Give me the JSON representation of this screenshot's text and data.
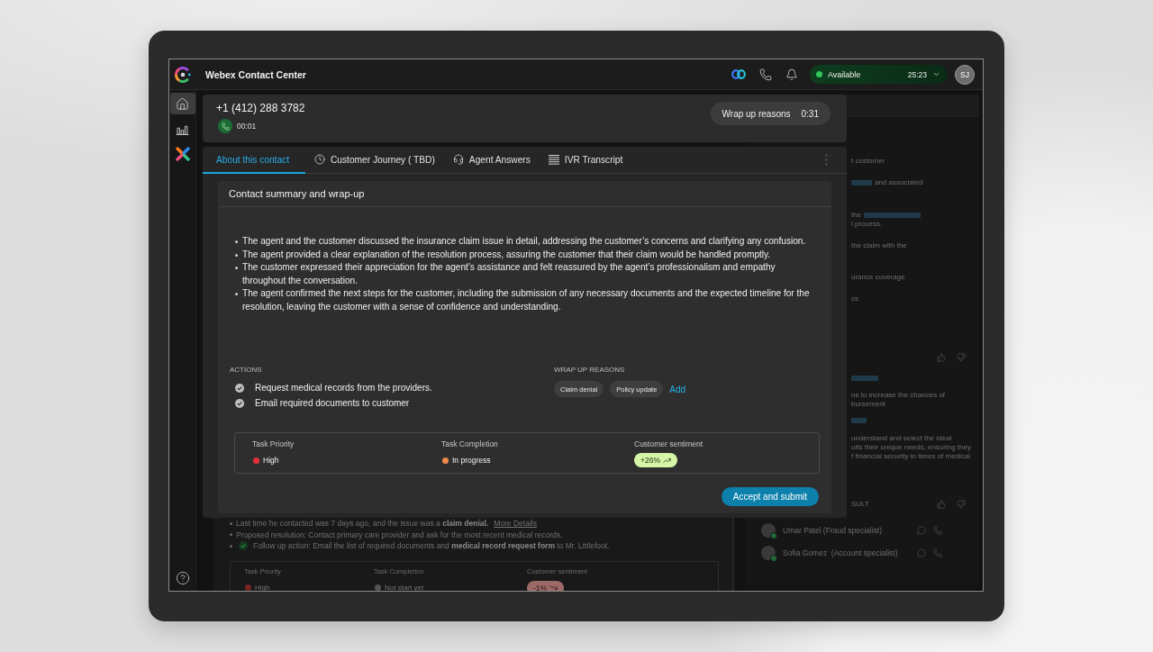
{
  "app_bar": {
    "title": "Webex Contact Center",
    "status": {
      "label": "Available",
      "timer": "25:23"
    },
    "avatar_initials": "SJ"
  },
  "nav_rail": {
    "items": [
      {
        "selected": true
      },
      {
        "selected": false
      },
      {
        "selected": false
      }
    ]
  },
  "call_header": {
    "phone_number": "+1 (412) 288 3782",
    "call_timer": "00:01",
    "wrap_up": {
      "label": "Wrap up reasons",
      "timer": "0:31"
    }
  },
  "tabs": [
    {
      "label": "About this contact",
      "selected": true
    },
    {
      "label": "Customer Journey ( TBD)",
      "selected": false
    },
    {
      "label": "Agent Answers",
      "selected": false
    },
    {
      "label": "IVR Transcript",
      "selected": false
    }
  ],
  "summary_card": {
    "title": "Contact summary and wrap-up",
    "summary": [
      "The agent and the customer discussed the insurance claim issue in detail, addressing the customer’s concerns and clarifying any confusion.",
      "The agent provided a clear explanation of the resolution process, assuring the customer that their claim would be handled promptly.",
      "The customer expressed their appreciation for the agent’s assistance and felt reassured by the agent’s professionalism and empathy throughout the conversation.",
      "The agent confirmed the next steps for the customer, including the submission of any necessary documents and the expected timeline for the resolution, leaving the customer with a sense of confidence and understanding."
    ],
    "actions": {
      "heading": "ACTIONS",
      "items": [
        {
          "text": "Request medical records from the providers.",
          "checked": true
        },
        {
          "text": "Email required documents to customer",
          "checked": true
        }
      ]
    },
    "wrap_up_reasons": {
      "heading": "WRAP UP REASONS",
      "chips": [
        "Claim denial",
        "Policy update"
      ],
      "add_link": "Add"
    },
    "metrics": [
      {
        "kind": "status",
        "label": "Task Priority",
        "value": "High",
        "color": "#e5303c"
      },
      {
        "kind": "status",
        "label": "Task Completion",
        "value": "In progress",
        "color": "#f08a4b"
      },
      {
        "kind": "rise",
        "label": "Customer sentiment",
        "value": "+26%"
      }
    ],
    "submit_button": "Accept and submit"
  },
  "background_summary": {
    "bullets": [
      {
        "text": "Last time he contacted was 7 days ago, and the issue was a **claim denial.**",
        "link": "More Details",
        "checked": false
      },
      {
        "text": "Proposed resolution: Contact primary care provider and ask for the most recent medical records.",
        "checked": false
      },
      {
        "text": "Follow up action: Email the list of required documents and **medical record request form** to Mr. Littlefoot.",
        "checked": true
      }
    ],
    "metrics": [
      {
        "kind": "status",
        "label": "Task Priority",
        "value": "High",
        "color": "#7a2226"
      },
      {
        "kind": "status",
        "label": "Task Completion",
        "value": "Not start yet",
        "color": "#555555"
      },
      {
        "kind": "fall",
        "label": "Customer sentiment",
        "value": "-1%"
      }
    ]
  },
  "assistant_panel": {
    "paragraphs": [
      {
        "lines": [
          {
            "parts": [
              {
                "kind": "text",
                "text": "t customer"
              }
            ]
          }
        ]
      },
      {
        "lines": [
          {
            "parts": [
              {
                "kind": "link"
              },
              {
                "kind": "text",
                "text": "and associated"
              }
            ]
          }
        ]
      },
      {
        "lines": [
          {
            "parts": [
              {
                "kind": "text",
                "text": "the"
              },
              {
                "kind": "link"
              }
            ]
          },
          {
            "parts": [
              {
                "kind": "text",
                "text": "l process."
              }
            ]
          }
        ]
      },
      {
        "lines": [
          {
            "parts": [
              {
                "kind": "text",
                "text": "the claim with the"
              }
            ]
          }
        ]
      },
      {
        "lines": [
          {
            "parts": [
              {
                "kind": "text",
                "text": "urance coverage"
              }
            ]
          }
        ]
      },
      {
        "lines": [
          {
            "parts": [
              {
                "kind": "text",
                "text": "cs"
              }
            ]
          }
        ]
      }
    ],
    "suggestions": [
      {
        "lines": [
          "ns to increase the chances of",
          "bursement"
        ]
      },
      {
        "lines": [
          "understand and select the ideal",
          "uits their unique needs, ensuring they",
          "f financial security in times of medical"
        ]
      }
    ],
    "consult_heading": "SULT",
    "experts": [
      {
        "name": "Umar Patel (Fraud specialist)",
        "online": true
      },
      {
        "name": "Sofia Gomez  (Account specialist)",
        "online": true
      }
    ]
  }
}
